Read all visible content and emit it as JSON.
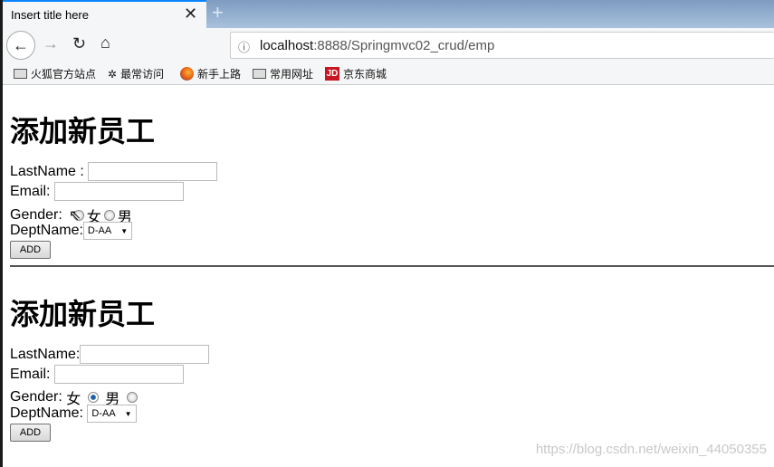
{
  "browser": {
    "tab_title": "Insert title here",
    "url_host": "localhost",
    "url_rest": ":8888/Springmvc02_crud/emp",
    "bookmarks": [
      {
        "label": "火狐官方站点",
        "icon": "folder-icon"
      },
      {
        "label": "最常访问",
        "icon": "gear-icon"
      },
      {
        "label": "新手上路",
        "icon": "firefox-icon"
      },
      {
        "label": "常用网址",
        "icon": "folder-icon"
      },
      {
        "label": "京东商城",
        "icon": "jd-icon",
        "icon_text": "JD"
      }
    ]
  },
  "form1": {
    "title": "添加新员工",
    "lastname_label": "LastName :",
    "email_label": "Email:",
    "gender_label": "Gender:",
    "female": "女",
    "male": "男",
    "dept_label": "DeptName:",
    "dept_value": "D-AA",
    "add": "ADD"
  },
  "form2": {
    "title": "添加新员工",
    "lastname_label": "LastName:",
    "email_label": "Email:",
    "gender_label": "Gender:",
    "female": "女",
    "male": "男",
    "gender_selected": "male",
    "dept_label": "DeptName:",
    "dept_value": "D-AA",
    "add": "ADD"
  },
  "watermark": "https://blog.csdn.net/weixin_44050355"
}
